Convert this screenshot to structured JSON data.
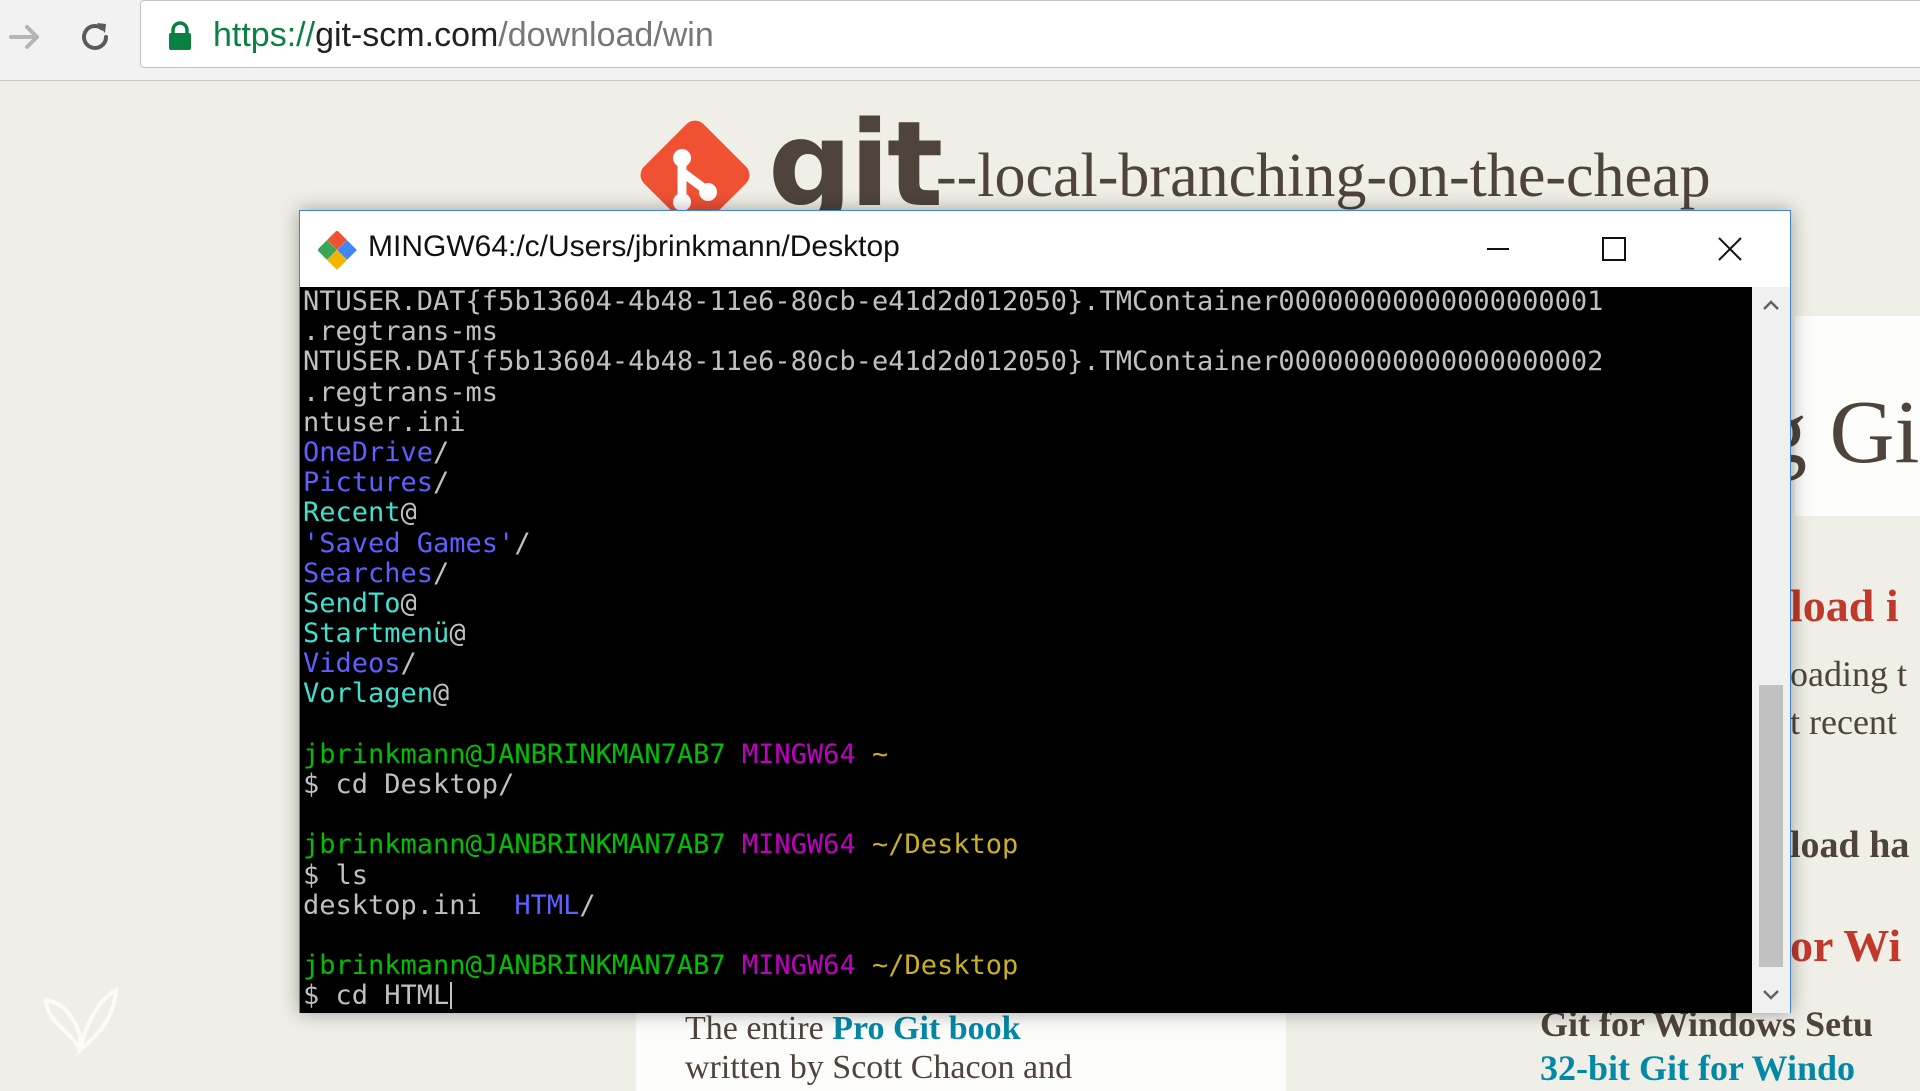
{
  "browser": {
    "url_scheme": "https://",
    "url_host": "git-scm.com",
    "url_path": "/download/win"
  },
  "page": {
    "logo_word": "git",
    "tagline": "--local-branching-on-the-cheap",
    "heading_partial": "g Gi",
    "download_heading_partial": "load i",
    "downloading_partial": "oading t",
    "recent_partial": "t recent",
    "download_has_partial": "load ha",
    "for_windows_partial": "or Wi",
    "book_text_prefix": "The entire ",
    "book_link": "Pro Git book",
    "book_text_line2": "written by Scott Chacon and",
    "gfw_setup_partial": "Git for Windows Setu",
    "gfw_32_partial": "32-bit Git for Windo",
    "colors": {
      "brand": "#f05133",
      "text": "#4e443c",
      "link": "#0388a6",
      "heading_red": "#c0392b"
    }
  },
  "terminal": {
    "title": "MINGW64:/c/Users/jbrinkmann/Desktop",
    "lines": [
      [
        {
          "t": "NTUSER.DAT{f5b13604-4b48-11e6-80cb-e41d2d012050}.TMContainer00000000000000000001",
          "c": "plain"
        }
      ],
      [
        {
          "t": ".regtrans-ms",
          "c": "plain"
        }
      ],
      [
        {
          "t": "NTUSER.DAT{f5b13604-4b48-11e6-80cb-e41d2d012050}.TMContainer00000000000000000002",
          "c": "plain"
        }
      ],
      [
        {
          "t": ".regtrans-ms",
          "c": "plain"
        }
      ],
      [
        {
          "t": "ntuser.ini",
          "c": "plain"
        }
      ],
      [
        {
          "t": "OneDrive",
          "c": "dir"
        },
        {
          "t": "/",
          "c": "plain"
        }
      ],
      [
        {
          "t": "Pictures",
          "c": "dir"
        },
        {
          "t": "/",
          "c": "plain"
        }
      ],
      [
        {
          "t": "Recent",
          "c": "link"
        },
        {
          "t": "@",
          "c": "plain"
        }
      ],
      [
        {
          "t": "'Saved Games'",
          "c": "dir"
        },
        {
          "t": "/",
          "c": "plain"
        }
      ],
      [
        {
          "t": "Searches",
          "c": "dir"
        },
        {
          "t": "/",
          "c": "plain"
        }
      ],
      [
        {
          "t": "SendTo",
          "c": "link"
        },
        {
          "t": "@",
          "c": "plain"
        }
      ],
      [
        {
          "t": "Startmenü",
          "c": "link"
        },
        {
          "t": "@",
          "c": "plain"
        }
      ],
      [
        {
          "t": "Videos",
          "c": "dir"
        },
        {
          "t": "/",
          "c": "plain"
        }
      ],
      [
        {
          "t": "Vorlagen",
          "c": "link"
        },
        {
          "t": "@",
          "c": "plain"
        }
      ],
      [],
      [
        {
          "t": "jbrinkmann@JANBRINKMAN7AB7",
          "c": "user"
        },
        {
          "t": " ",
          "c": "plain"
        },
        {
          "t": "MINGW64",
          "c": "sys"
        },
        {
          "t": " ~",
          "c": "path"
        }
      ],
      [
        {
          "t": "$ cd Desktop/",
          "c": "plain"
        }
      ],
      [],
      [
        {
          "t": "jbrinkmann@JANBRINKMAN7AB7",
          "c": "user"
        },
        {
          "t": " ",
          "c": "plain"
        },
        {
          "t": "MINGW64",
          "c": "sys"
        },
        {
          "t": " ~/Desktop",
          "c": "path"
        }
      ],
      [
        {
          "t": "$ ls",
          "c": "plain"
        }
      ],
      [
        {
          "t": "desktop.ini  ",
          "c": "plain"
        },
        {
          "t": "HTML",
          "c": "dir"
        },
        {
          "t": "/",
          "c": "plain"
        }
      ],
      [],
      [
        {
          "t": "jbrinkmann@JANBRINKMAN7AB7",
          "c": "user"
        },
        {
          "t": " ",
          "c": "plain"
        },
        {
          "t": "MINGW64",
          "c": "sys"
        },
        {
          "t": " ~/Desktop",
          "c": "path"
        }
      ],
      [
        {
          "t": "$ cd HTML",
          "c": "plain"
        },
        {
          "t": "",
          "c": "cursor"
        }
      ]
    ],
    "colors": {
      "background": "#000000",
      "plain": "#c0c0c0",
      "dir": "#5f5fff",
      "link": "#40e0d0",
      "user": "#00c000",
      "sys": "#c000c0",
      "path": "#c8b020"
    }
  },
  "icons": {
    "forward": "arrow-right-icon",
    "reload": "reload-icon",
    "lock": "lock-icon",
    "git_logo": "git-logo-icon",
    "terminal_app": "git-bash-icon",
    "minimize": "minimize-icon",
    "maximize": "maximize-icon",
    "close": "close-icon",
    "scroll_up": "chevron-up-icon",
    "scroll_down": "chevron-down-icon",
    "watermark": "butterfly-icon"
  }
}
